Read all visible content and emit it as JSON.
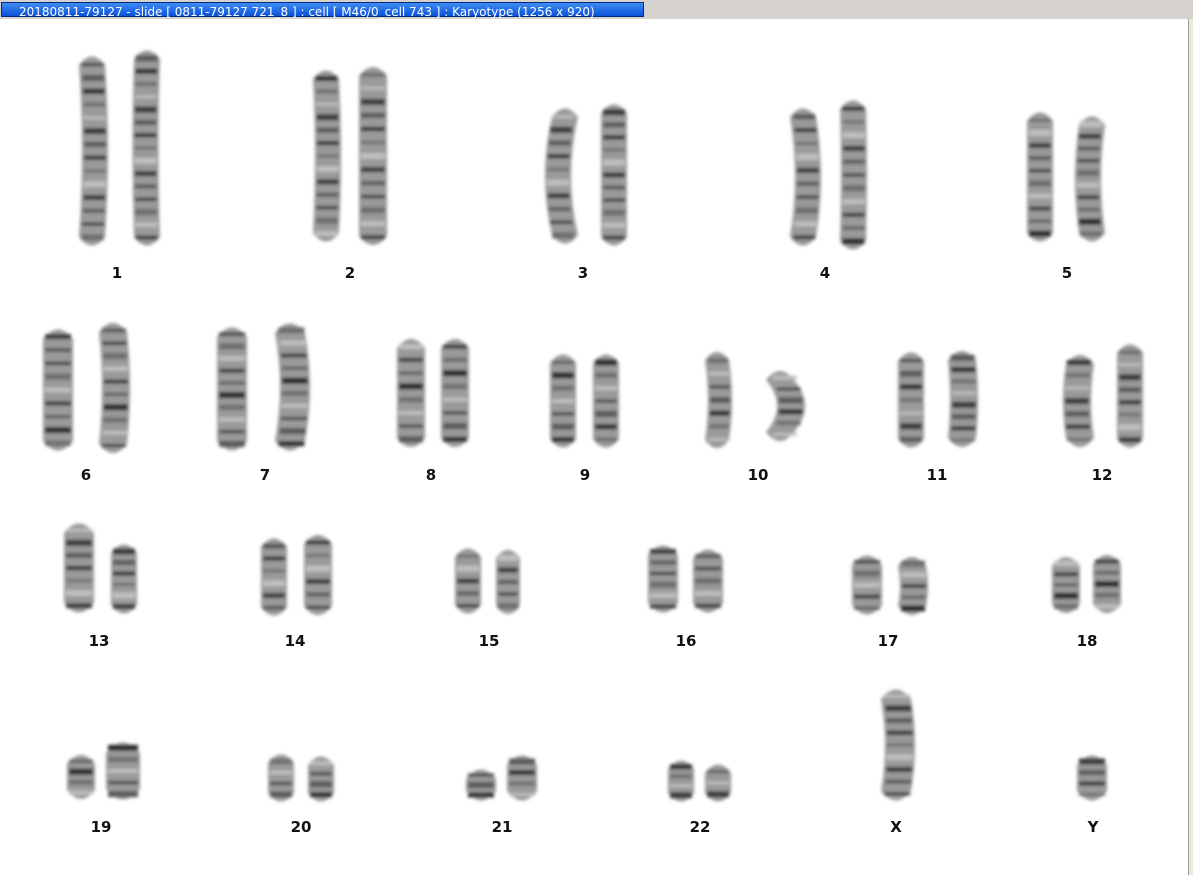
{
  "window": {
    "title": "20180811-79127 - slide [ 0811-79127 721_8 ] : cell [ M46/0_cell 743 ] : Karyotype  (1256 x 920)"
  },
  "karyotype": {
    "chromosomes": [
      {
        "label": "1"
      },
      {
        "label": "2"
      },
      {
        "label": "3"
      },
      {
        "label": "4"
      },
      {
        "label": "5"
      },
      {
        "label": "6"
      },
      {
        "label": "7"
      },
      {
        "label": "8"
      },
      {
        "label": "9"
      },
      {
        "label": "10"
      },
      {
        "label": "11"
      },
      {
        "label": "12"
      },
      {
        "label": "13"
      },
      {
        "label": "14"
      },
      {
        "label": "15"
      },
      {
        "label": "16"
      },
      {
        "label": "17"
      },
      {
        "label": "18"
      },
      {
        "label": "19"
      },
      {
        "label": "20"
      },
      {
        "label": "21"
      },
      {
        "label": "22"
      },
      {
        "label": "X"
      },
      {
        "label": "Y"
      }
    ]
  }
}
